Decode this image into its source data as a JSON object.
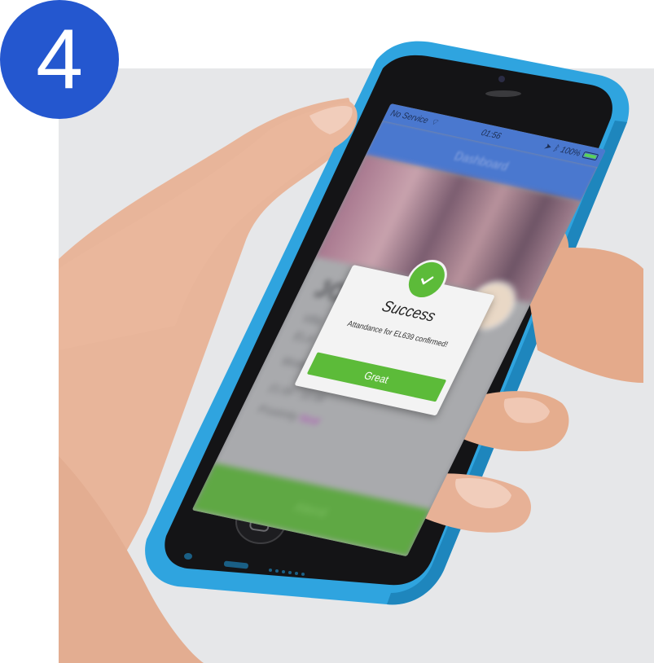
{
  "step_number": "4",
  "status_bar": {
    "carrier": "No Service",
    "time": "01:56",
    "battery": "100%",
    "battery_level": 1.0
  },
  "app": {
    "nav_title": "Dashboard",
    "event_code": "JO",
    "line_1": "Villa",
    "line_2": "ELA",
    "line_3": "Workshop Notes",
    "line_4": "21:00 - 12:00",
    "line_5_label": "Proximity",
    "line_5_value": "Near",
    "action_button": "Attend"
  },
  "dialog": {
    "title": "Success",
    "message": "Attandance for EL639 confirmed!",
    "button_label": "Great"
  },
  "colors": {
    "badge": "#2457cf",
    "phone_body": "#2fa4df",
    "success_green": "#5cbb39",
    "nav_blue": "#4a78cf"
  },
  "icons": [
    "checkmark-icon",
    "wifi-icon",
    "location-arrow-icon",
    "bluetooth-icon",
    "battery-icon",
    "home-button-icon"
  ]
}
